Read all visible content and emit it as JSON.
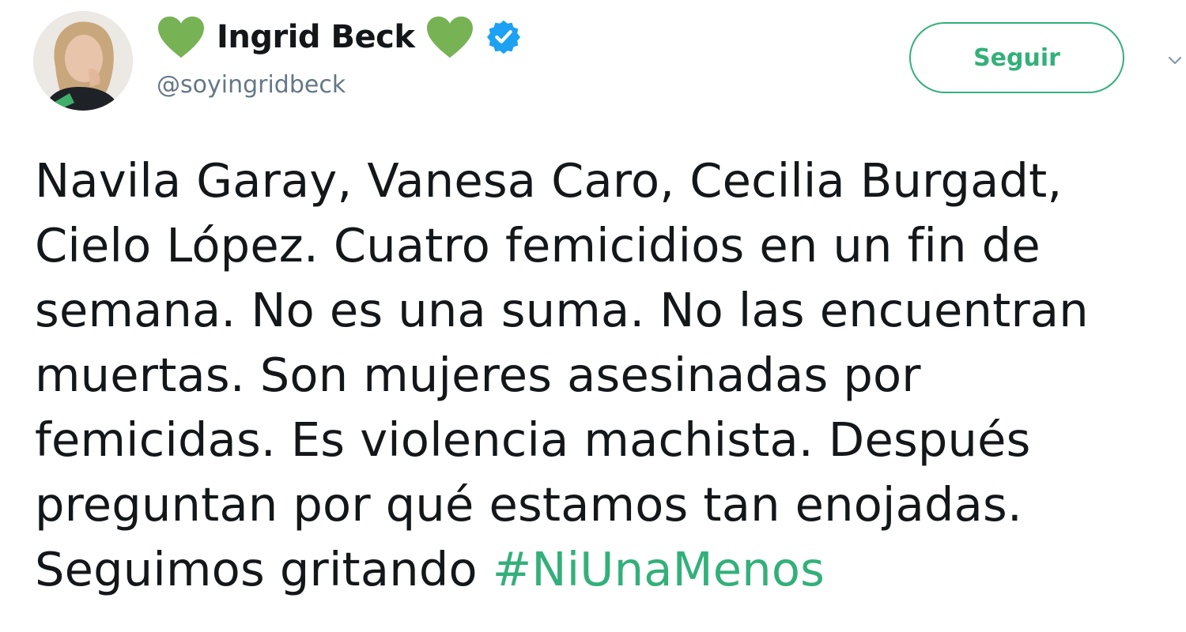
{
  "user": {
    "display_name": "Ingrid Beck",
    "handle": "@soyingridbeck",
    "verified": true,
    "name_prefix_icon": "green-heart-icon",
    "name_suffix_icon": "green-heart-icon",
    "avatar_icon": "user-avatar"
  },
  "actions": {
    "follow_label": "Seguir",
    "menu_icon": "chevron-down-icon"
  },
  "tweet": {
    "lines": [
      "Navila Garay, Vanesa Caro, Cecilia Burgadt,",
      "Cielo López. Cuatro femicidios en un fin de",
      "semana. No es una suma. No las encuentran",
      "muertas. Son mujeres asesinadas por",
      "femicidas. Es violencia machista. Después",
      "preguntan por qué estamos tan enojadas."
    ],
    "last_line_text": "Seguimos gritando ",
    "hashtag": "#NiUnaMenos"
  },
  "colors": {
    "accent": "#33b07a",
    "heart": "#77b255",
    "verified_badge": "#1da1f2",
    "text": "#14171a",
    "secondary_text": "#657786"
  }
}
